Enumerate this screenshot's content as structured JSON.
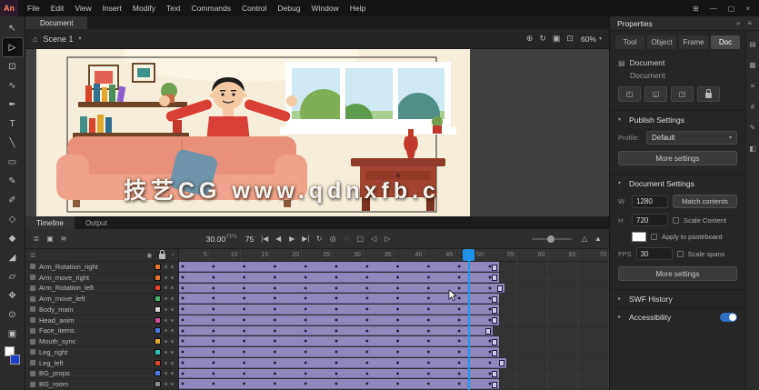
{
  "window": {
    "logo": "An",
    "controls": [
      {
        "name": "workspace-icon",
        "glyph": "⊞"
      },
      {
        "name": "minimize-icon",
        "glyph": "—"
      },
      {
        "name": "maximize-icon",
        "glyph": "▢"
      },
      {
        "name": "close-icon",
        "glyph": "×"
      }
    ]
  },
  "menubar": {
    "items": [
      "File",
      "Edit",
      "View",
      "Insert",
      "Modify",
      "Text",
      "Commands",
      "Control",
      "Debug",
      "Window",
      "Help"
    ]
  },
  "doc_tab": "Document",
  "stage_toolbar": {
    "scene": "Scene 1",
    "zoom": "60%",
    "icons": [
      {
        "name": "center-stage-icon",
        "glyph": "⊕"
      },
      {
        "name": "rotation-icon",
        "glyph": "↻"
      },
      {
        "name": "clip-content-icon",
        "glyph": "▣"
      },
      {
        "name": "fit-view-icon",
        "glyph": "⊡"
      }
    ]
  },
  "stage": {
    "watermark": "技艺CG  www.qdnxfb.c"
  },
  "tools": [
    {
      "name": "selection-tool",
      "glyph": "↖"
    },
    {
      "name": "subselection-tool",
      "glyph": "▷"
    },
    {
      "name": "free-transform-tool",
      "glyph": "⊡"
    },
    {
      "name": "lasso-tool",
      "glyph": "∿"
    },
    {
      "name": "pen-tool",
      "glyph": "✒"
    },
    {
      "name": "text-tool",
      "glyph": "T"
    },
    {
      "name": "line-tool",
      "glyph": "╲"
    },
    {
      "name": "rectangle-tool",
      "glyph": "▭"
    },
    {
      "name": "pencil-tool",
      "glyph": "✎"
    },
    {
      "name": "brush-tool",
      "glyph": "✐"
    },
    {
      "name": "asset-warp-tool",
      "glyph": "◇"
    },
    {
      "name": "paint-bucket-tool",
      "glyph": "◆"
    },
    {
      "name": "eyedropper-tool",
      "glyph": "◢"
    },
    {
      "name": "eraser-tool",
      "glyph": "▱"
    },
    {
      "name": "hand-tool",
      "glyph": "✥"
    },
    {
      "name": "zoom-tool",
      "glyph": "⊙"
    },
    {
      "name": "camera-tool",
      "glyph": "▣"
    }
  ],
  "timeline": {
    "tabs": [
      "Timeline",
      "Output"
    ],
    "fps_value": "30.00",
    "fps_unit": "FPS",
    "sec_value": "75",
    "icons_left": [
      {
        "name": "layers-icon",
        "glyph": "≣"
      },
      {
        "name": "camera-icon",
        "glyph": "▣"
      },
      {
        "name": "advanced-layers-icon",
        "glyph": "≋"
      }
    ],
    "icons_transport": [
      {
        "name": "go-to-first-frame-icon",
        "glyph": "|◀"
      },
      {
        "name": "step-back-icon",
        "glyph": "◀"
      },
      {
        "name": "play-icon",
        "glyph": "▶"
      },
      {
        "name": "step-forward-icon",
        "glyph": "▶|"
      },
      {
        "name": "loop-icon",
        "glyph": "↻"
      }
    ],
    "icons_onion": [
      {
        "name": "onion-skin-icon",
        "glyph": "◎"
      },
      {
        "name": "onion-outline-icon",
        "glyph": "◌"
      },
      {
        "name": "edit-multiple-frames-icon",
        "glyph": "▢"
      },
      {
        "name": "jump-back-icon",
        "glyph": "◁"
      },
      {
        "name": "jump-forward-icon",
        "glyph": "▷"
      }
    ],
    "icons_zoom": [
      {
        "name": "zoom-out-frames-icon",
        "glyph": "△"
      },
      {
        "name": "zoom-in-frames-icon",
        "glyph": "▲"
      }
    ],
    "ruler": [
      "5",
      "10",
      "15",
      "20",
      "25",
      "30",
      "35",
      "40",
      "45",
      "50",
      "55",
      "60",
      "65",
      "70"
    ],
    "layers": [
      {
        "name": "Arm_Rotation_right",
        "color": "#e0722f"
      },
      {
        "name": "Arm_move_right",
        "color": "#e0722f"
      },
      {
        "name": "Arm_Rotation_left",
        "color": "#d8452c"
      },
      {
        "name": "Arm_move_left",
        "color": "#49b06a"
      },
      {
        "name": "Body_main",
        "color": "#d8d2d0"
      },
      {
        "name": "Head_anim",
        "color": "#c94f96"
      },
      {
        "name": "Face_items",
        "color": "#4a7bd8"
      },
      {
        "name": "Mouth_sync",
        "color": "#e0a62f"
      },
      {
        "name": "Leg_right",
        "color": "#35b8b0"
      },
      {
        "name": "Leg_left",
        "color": "#d8452c"
      },
      {
        "name": "BG_props",
        "color": "#4a7bd8"
      },
      {
        "name": "BG_room",
        "color": "#8a8a8a"
      }
    ]
  },
  "properties": {
    "title": "Properties",
    "header_icons": [
      {
        "name": "collapse-panel-icon",
        "glyph": "»"
      },
      {
        "name": "panel-menu-icon",
        "glyph": "≡"
      }
    ],
    "tabs": [
      "Tool",
      "Object",
      "Frame",
      "Doc"
    ],
    "doc_type": "Document",
    "doc_name": "Document",
    "quick_buttons": [
      {
        "name": "publish-settings-icon",
        "glyph": "◰"
      },
      {
        "name": "profiles-icon",
        "glyph": "◱"
      },
      {
        "name": "fonts-icon",
        "glyph": "◳"
      }
    ],
    "publish": {
      "title": "Publish Settings",
      "profile_label": "Profile:",
      "profile_value": "Default",
      "more_label": "More settings"
    },
    "doc_settings": {
      "title": "Document Settings",
      "w_label": "W",
      "w": "1280",
      "match_label": "Match contents",
      "h_label": "H",
      "h": "720",
      "scale_label": "Scale Content",
      "apply_label": "Apply to pasteboard",
      "fps_label": "FPS",
      "fps": "30",
      "spans_label": "Scale spans",
      "more_label": "More settings"
    },
    "swf": {
      "title": "SWF History"
    },
    "accessibility": {
      "title": "Accessibility"
    },
    "dock_icons": [
      {
        "name": "color-panel-icon",
        "glyph": "▤"
      },
      {
        "name": "swatches-panel-icon",
        "glyph": "▦"
      },
      {
        "name": "align-panel-icon",
        "glyph": "≡"
      },
      {
        "name": "libraries-panel-icon",
        "glyph": "#"
      },
      {
        "name": "brushes-panel-icon",
        "glyph": "✎"
      },
      {
        "name": "history-panel-icon",
        "glyph": "◧"
      }
    ]
  }
}
